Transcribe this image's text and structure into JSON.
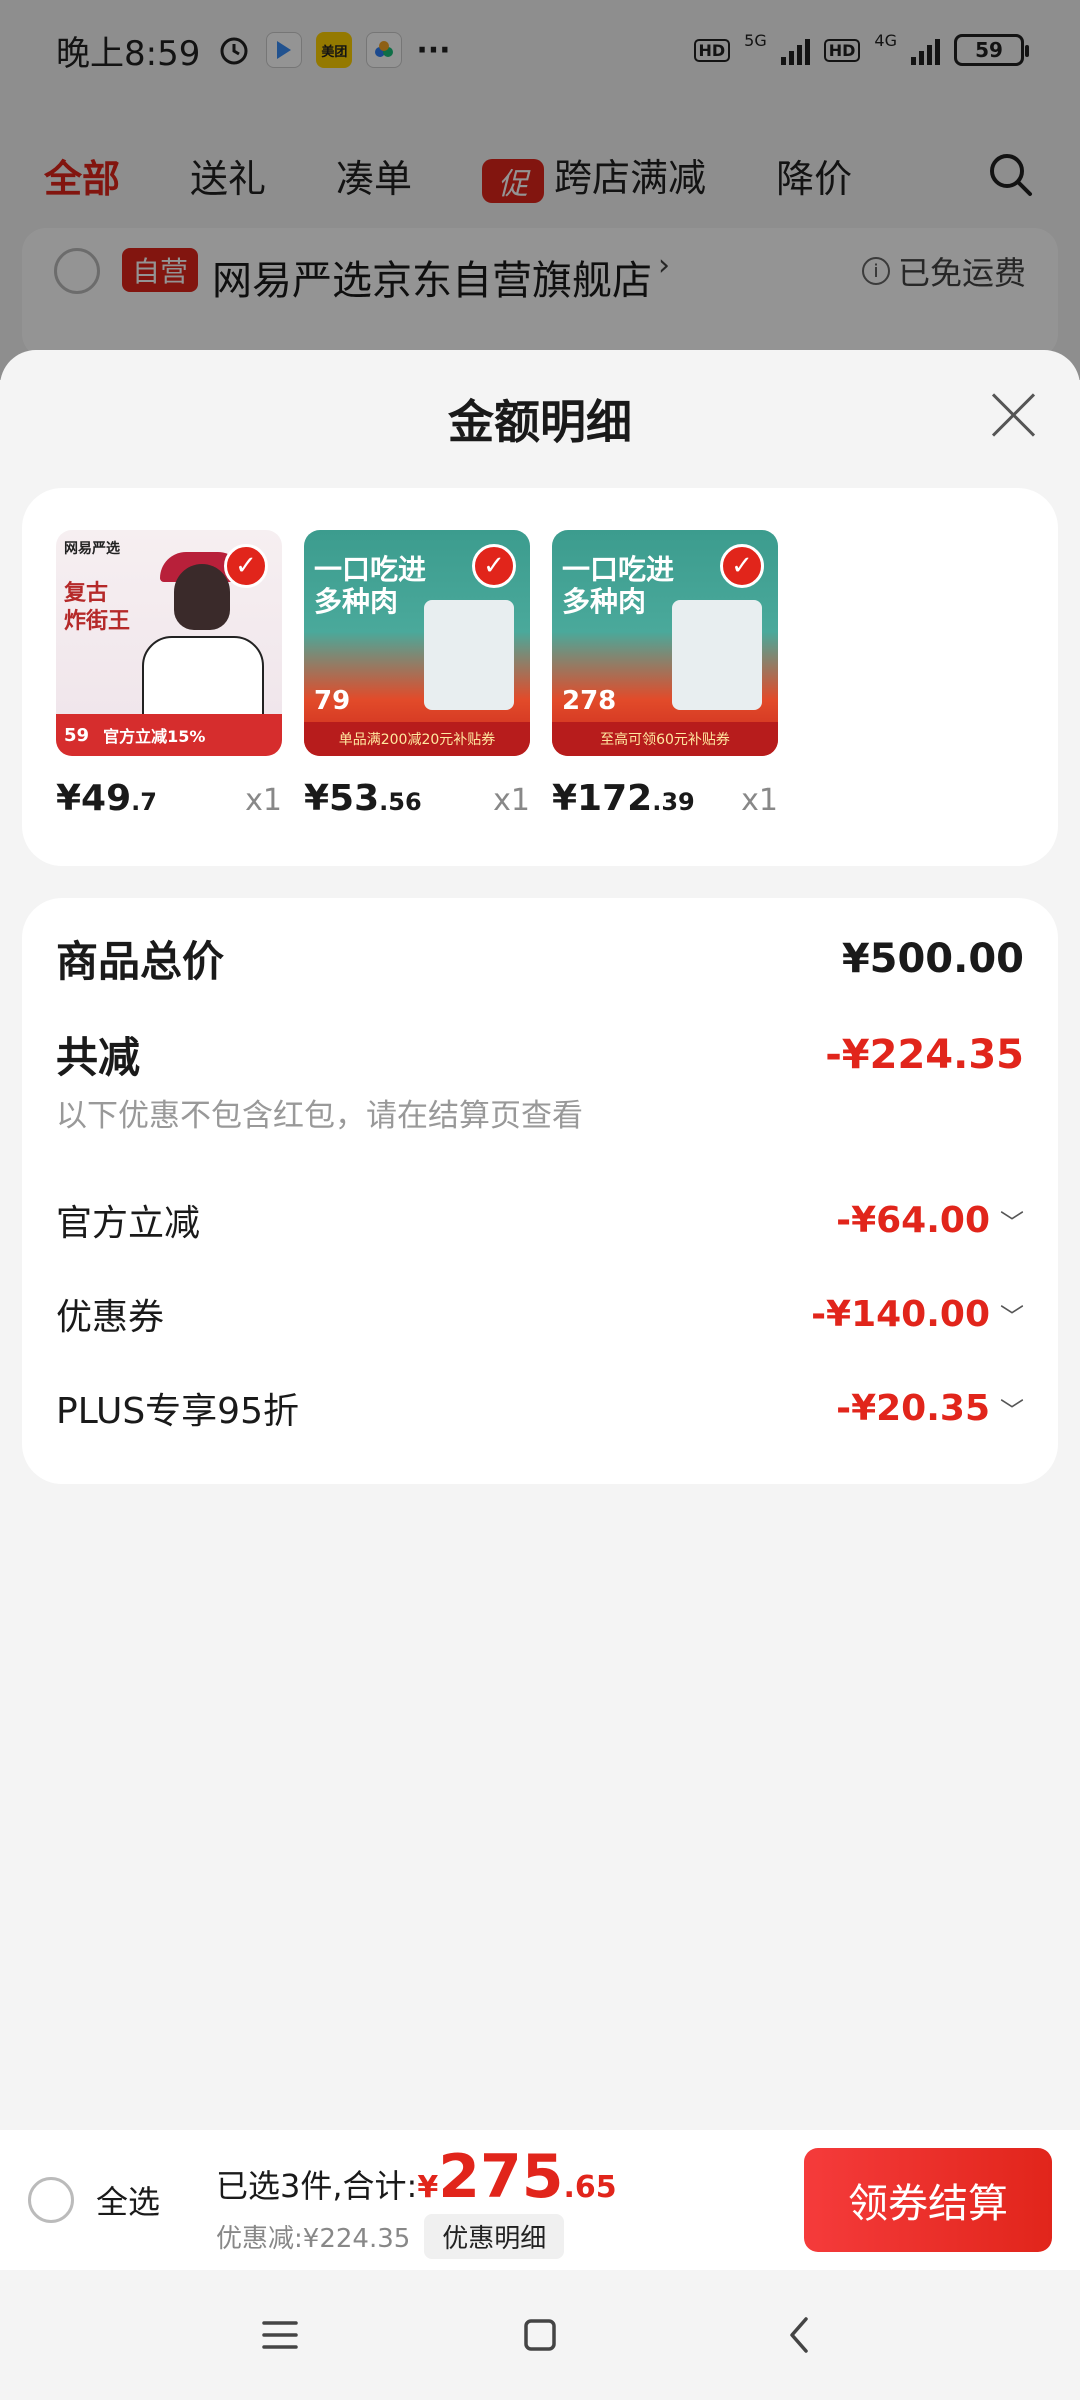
{
  "status_bar": {
    "time": "晚上8:59",
    "app_label_meituan": "美团",
    "more": "···",
    "hd": "HD",
    "net1": "5G",
    "net2": "4G",
    "battery": "59"
  },
  "tabs": [
    {
      "label": "全部",
      "active": true
    },
    {
      "label": "送礼"
    },
    {
      "label": "凑单"
    },
    {
      "label": "跨店满减",
      "promo_tag": "促"
    },
    {
      "label": "降价"
    }
  ],
  "store": {
    "self_tag": "自营",
    "name": "网易严选京东自营旗舰店",
    "chevron": "›",
    "info_icon": "i",
    "shipping": "已免运费"
  },
  "sheet": {
    "title": "金额明细",
    "products": [
      {
        "price_int": "¥49",
        "price_dec": ".7",
        "qty": "x1",
        "thumb": {
          "brand": "网易严选",
          "headline_1": "复古",
          "headline_2": "炸街王",
          "banner": "官方立减15%",
          "price": "59"
        }
      },
      {
        "price_int": "¥53",
        "price_dec": ".56",
        "qty": "x1",
        "thumb": {
          "headline_1": "一口吃进",
          "headline_2": "多种肉",
          "price": "79",
          "banner": "单品满200减20元补贴券"
        }
      },
      {
        "price_int": "¥172",
        "price_dec": ".39",
        "qty": "x1",
        "thumb": {
          "headline_1": "一口吃进",
          "headline_2": "多种肉",
          "price": "278",
          "banner": "至高可领60元补贴券"
        }
      }
    ],
    "summary": {
      "total_label": "商品总价",
      "total_value": "¥500.00",
      "reduce_label": "共减",
      "reduce_value": "-¥224.35",
      "note": "以下优惠不包含红包，请在结算页查看",
      "items": [
        {
          "label": "官方立减",
          "value": "-¥64.00"
        },
        {
          "label": "优惠券",
          "value": "-¥140.00"
        },
        {
          "label": "PLUS专享95折",
          "value": "-¥20.35"
        }
      ],
      "chevron": "﹀"
    }
  },
  "checkout": {
    "select_all": "全选",
    "summary_prefix": "已选3件,合计:",
    "currency": "¥",
    "amount_int": "275",
    "amount_dec": ".65",
    "discount_text": "优惠减:¥224.35",
    "detail_button": "优惠明细",
    "checkout_button": "领券结算"
  },
  "colors": {
    "accent": "#e1251b",
    "sheet_bg": "#f4f4f4"
  }
}
